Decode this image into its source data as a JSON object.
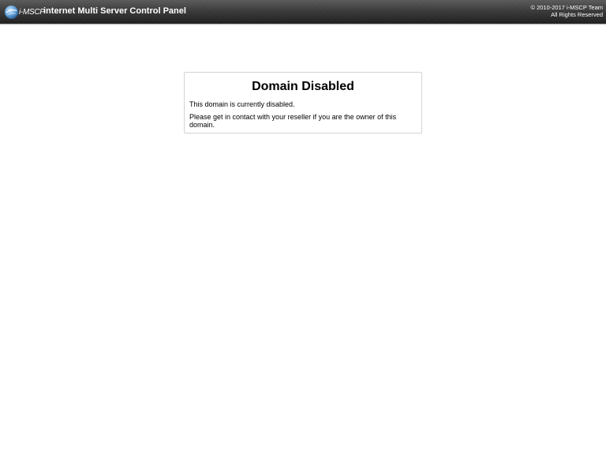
{
  "header": {
    "logo_text": "i-MSCP",
    "brand": "internet Multi Server Control Panel",
    "copyright_line1": "© 2010-2017 i-MSCP Team",
    "copyright_line2": "All Rights Reserved",
    "logo_icon": "imscp-globe-logo"
  },
  "main": {
    "title": "Domain Disabled",
    "message1": "This domain is currently disabled.",
    "message2": "Please get in contact with your reseller if you are the owner of this domain."
  },
  "colors": {
    "header_dark": "#1e1e1e",
    "header_light": "#5a5a5a",
    "panel_border": "#d4d4d4"
  }
}
